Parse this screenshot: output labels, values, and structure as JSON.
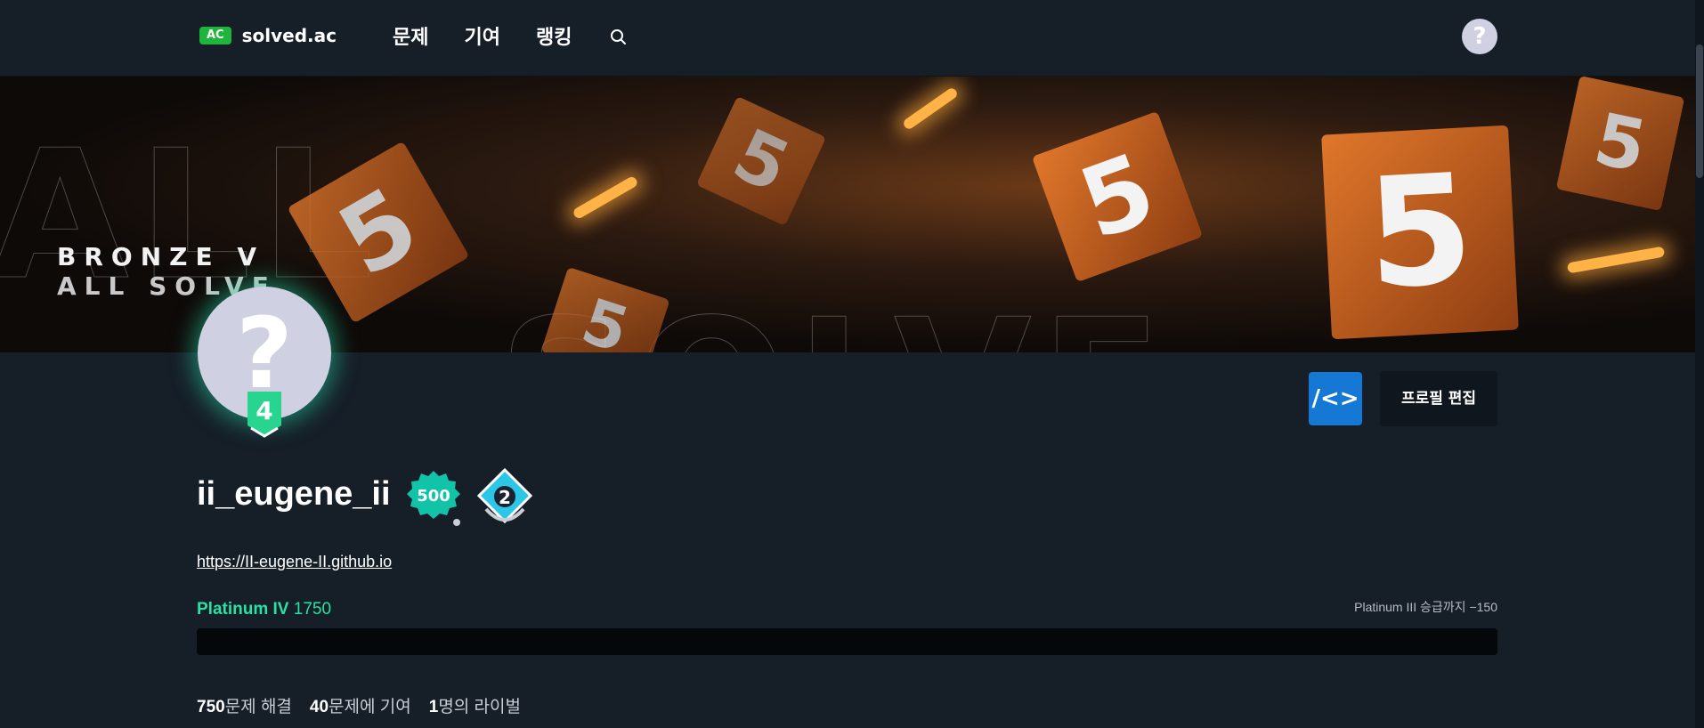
{
  "header": {
    "logo_badge": "AC",
    "logo_text": "solved.ac",
    "nav": [
      {
        "label": "문제"
      },
      {
        "label": "기여"
      },
      {
        "label": "랭킹"
      }
    ],
    "search_icon": "search-icon",
    "help_icon": "help-icon"
  },
  "banner": {
    "title": "BRONZE V",
    "subtitle": "ALL SOLVE",
    "background_colors": {
      "accent": "#e0772b",
      "dark": "#0a0807"
    }
  },
  "profile": {
    "avatar_glyph": "?",
    "tier_level": "4",
    "username": "ii_eugene_ii",
    "badges": [
      {
        "label": "500",
        "color": "#12c4a7"
      },
      {
        "label": "2",
        "color": "#2cc6e6"
      }
    ],
    "website": "https://II-eugene-II.github.io",
    "tier": "Platinum IV",
    "rating": "1750",
    "next_tier_text": "Platinum III 승급까지 −150",
    "progress_fraction": 0,
    "stats": [
      {
        "value": "750",
        "label": "문제 해결"
      },
      {
        "value": "40",
        "label": "문제에 기여"
      },
      {
        "value": "1",
        "label": "명의 라이벌"
      }
    ]
  },
  "actions": {
    "code_button": "/<>",
    "edit_button": "프로필 편집"
  },
  "colors": {
    "background": "#161e28",
    "platinum": "#27e2a4",
    "code_button": "#1478d4"
  }
}
